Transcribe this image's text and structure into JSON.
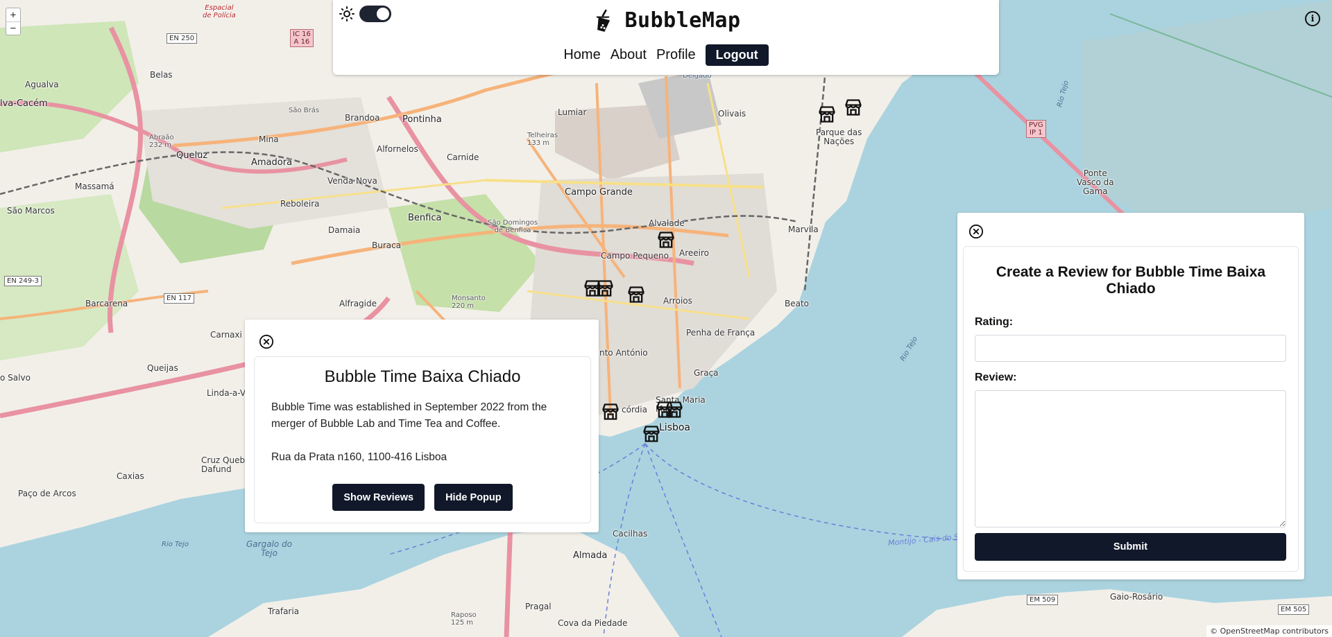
{
  "app": {
    "title": "BubbleMap"
  },
  "nav": {
    "items": [
      {
        "label": "Home"
      },
      {
        "label": "About"
      },
      {
        "label": "Profile"
      }
    ],
    "logout_label": "Logout"
  },
  "map": {
    "zoom_in": "+",
    "zoom_out": "−",
    "info_glyph": "i",
    "attribution": "© OpenStreetMap contributors",
    "labels": {
      "agualva": "Agualva",
      "alva_cacem": "lva-Cacém",
      "belas": "Belas",
      "queluz": "Queluz",
      "massama": "Massamá",
      "amadora": "Amadora",
      "sao_marcos": "São Marcos",
      "mina": "Mina",
      "sao_bras": "São Brás",
      "brandoa": "Brandoa",
      "pontinha": "Pontinha",
      "alfornelos": "Alfornelos",
      "carnide": "Carnide",
      "lumiar": "Lumiar",
      "olivais": "Olivais",
      "parque_nacoes": "Parque das\nNações",
      "venda_nova": "Venda Nova",
      "reboleira": "Reboleira",
      "damaia": "Damaia",
      "benfica": "Benfica",
      "sao_domingos": "São Domingos\nde Benfica",
      "campo_grande": "Campo Grande",
      "alvalade": "Alvalade",
      "areeiro": "Areeiro",
      "campo_pequeno": "Campo Pequeno",
      "marvila": "Marvila",
      "barcarena": "Barcarena",
      "buraca": "Buraca",
      "alfragide": "Alfragide",
      "arroios": "Arroios",
      "beato": "Beato",
      "carnaxide": "Carnaxi",
      "penha": "Penha de França",
      "santo_antonio": "nto António",
      "graca": "Graça",
      "queijas": "Queijas",
      "linda_velha": "Linda-a-V",
      "salvo": "o Salvo",
      "santa_maria": "Santa Maria\nMaior",
      "concordia": "córdia",
      "lisboa": "Lisboa",
      "caxias": "Caxias",
      "cruz_quebrada": "Cruz Queb\nDafund",
      "paco_arcos": "Paço de Arcos",
      "gargalo": "Gargalo do\nTejo",
      "cacilhas": "Cacilhas",
      "almada": "Almada",
      "trafaria": "Trafaria",
      "pragal": "Pragal",
      "cova_piedade": "Cova da Piedade",
      "raposo": "Raposo\n125 m",
      "gaio_rosario": "Gaio-Rosário",
      "ponte_vasco": "Ponte\nVasco da\nGama",
      "monsanto": "Monsanto\n220 m",
      "abraao": "Abraão\n232 m",
      "rio_tejo_1": "Rio Tejo",
      "rio_tejo_2": "Rio Tejo",
      "rio_tejo_3": "Rio Tejo",
      "montijo": "Montijo - Cais do Sod",
      "espacial_policia": "Espacial\nde Polícia",
      "delgado": "Delgado",
      "telheiras": "Telheiras\n133 m"
    },
    "shields": {
      "en250": "EN 250",
      "ic16": "IC 16\nA 16",
      "en249": "EN 249-3",
      "en117": "EN 117",
      "pvg": "PVG\nIP 1",
      "em509": "EM 509",
      "em505": "EM 505"
    }
  },
  "popup": {
    "title": "Bubble Time Baixa Chiado",
    "description": "Bubble Time was established in September 2022 from the merger of Bubble Lab and Time Tea and Coffee.",
    "address": "Rua da Prata n160, 1100-416 Lisboa",
    "show_reviews_label": "Show Reviews",
    "hide_popup_label": "Hide Popup"
  },
  "review_form": {
    "title": "Create a Review for Bubble Time Baixa Chiado",
    "rating_label": "Rating:",
    "rating_value": "",
    "review_label": "Review:",
    "review_value": "",
    "submit_label": "Submit"
  },
  "colors": {
    "accent_dark": "#10182a",
    "water": "#aad3df",
    "land": "#f2efe9"
  }
}
